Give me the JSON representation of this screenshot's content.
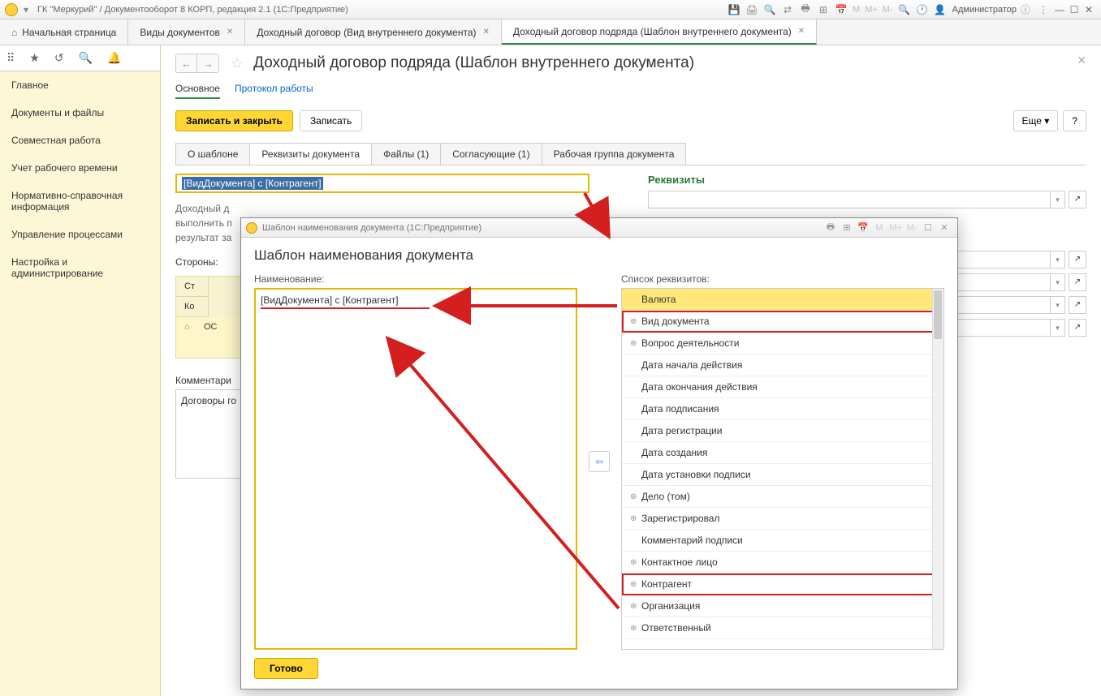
{
  "titlebar": {
    "app_title": "ГК \"Меркурий\" / Документооборот 8 КОРП, редакция 2.1  (1С:Предприятие)",
    "m_labels": [
      "M",
      "M+",
      "M-"
    ],
    "user": "Администратор"
  },
  "tabs": {
    "home": "Начальная страница",
    "t1": "Виды документов",
    "t2": "Доходный договор (Вид внутреннего документа)",
    "t3": "Доходный договор подряда (Шаблон внутреннего документа)"
  },
  "sidebar": {
    "items": [
      "Главное",
      "Документы и файлы",
      "Совместная работа",
      "Учет рабочего времени",
      "Нормативно-справочная информация",
      "Управление процессами",
      "Настройка и администрирование"
    ]
  },
  "content": {
    "title": "Доходный договор подряда (Шаблон внутреннего документа)",
    "view_tabs": {
      "main": "Основное",
      "protocol": "Протокол работы"
    },
    "buttons": {
      "save_close": "Записать и закрыть",
      "save": "Записать",
      "more": "Еще",
      "help": "?"
    },
    "sub_tabs": [
      "О шаблоне",
      "Реквизиты документа",
      "Файлы (1)",
      "Согласующие (1)",
      "Рабочая группа документа"
    ],
    "selected_field": "[ВидДокумента] с [Контрагент]",
    "desc_lines": [
      "Доходный д",
      "выполнить п",
      "результат за"
    ],
    "sides_label": "Стороны:",
    "table": {
      "h1": "Ст",
      "h2": "Ко",
      "r1": "ОС"
    },
    "comment_label": "Комментари",
    "comment_value": "Договоры го"
  },
  "right_panel": {
    "title": "Реквизиты"
  },
  "modal": {
    "titlebar": "Шаблон наименования документа  (1С:Предприятие)",
    "m_labels": [
      "M",
      "M+",
      "M-"
    ],
    "h1": "Шаблон наименования документа",
    "name_label": "Наименование:",
    "name_value": "[ВидДокумента] с [Контрагент]",
    "list_label": "Список реквизитов:",
    "items": [
      {
        "label": "Валюта",
        "plus": false,
        "hl": true
      },
      {
        "label": "Вид документа",
        "plus": true,
        "boxed": true
      },
      {
        "label": "Вопрос деятельности",
        "plus": true
      },
      {
        "label": "Дата начала действия",
        "plus": false
      },
      {
        "label": "Дата окончания действия",
        "plus": false
      },
      {
        "label": "Дата подписания",
        "plus": false
      },
      {
        "label": "Дата регистрации",
        "plus": false
      },
      {
        "label": "Дата создания",
        "plus": false
      },
      {
        "label": "Дата установки подписи",
        "plus": false
      },
      {
        "label": "Дело (том)",
        "plus": true
      },
      {
        "label": "Зарегистрировал",
        "plus": true
      },
      {
        "label": "Комментарий подписи",
        "plus": false
      },
      {
        "label": "Контактное лицо",
        "plus": true
      },
      {
        "label": "Контрагент",
        "plus": true,
        "boxed": true
      },
      {
        "label": "Организация",
        "plus": true
      },
      {
        "label": "Ответственный",
        "plus": true
      }
    ],
    "ready": "Готово"
  }
}
